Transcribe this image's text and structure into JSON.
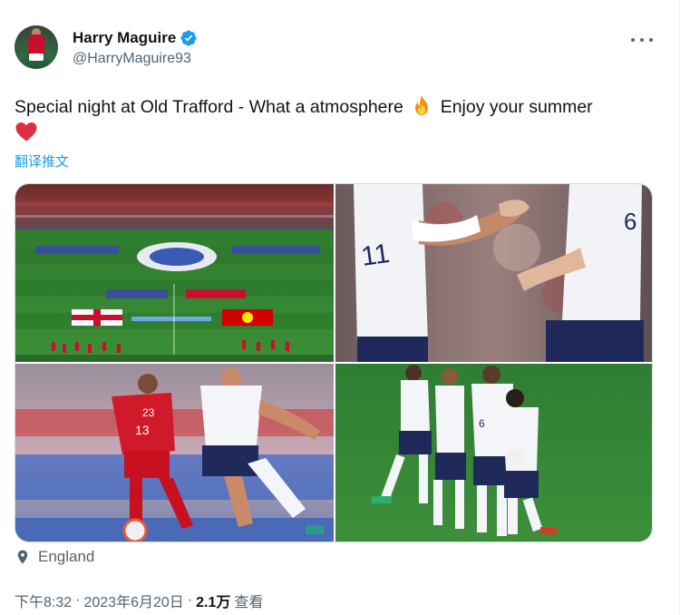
{
  "author": {
    "display_name": "Harry Maguire",
    "handle": "@HarryMaguire93",
    "verified": true
  },
  "tweet": {
    "text_before_emoji": "Special night at Old Trafford - What a atmosphere",
    "text_after_emoji": "Enjoy your summer",
    "emojis": [
      "fire-emoji",
      "red-heart-emoji"
    ],
    "translate_label": "翻译推文",
    "location": "England"
  },
  "meta": {
    "time": "下午8:32",
    "separator": "·",
    "date": "2023年6月20日",
    "views_count": "2.1万",
    "views_label": "查看"
  },
  "media": {
    "images": [
      "stadium-lineup-photo",
      "players-hand-slap-photo",
      "match-action-photo",
      "team-celebration-photo"
    ]
  },
  "colors": {
    "link": "#1d9bf0",
    "secondary_text": "#536471",
    "primary_text": "#0f1419",
    "verified_badge": "#1d9bf0"
  }
}
